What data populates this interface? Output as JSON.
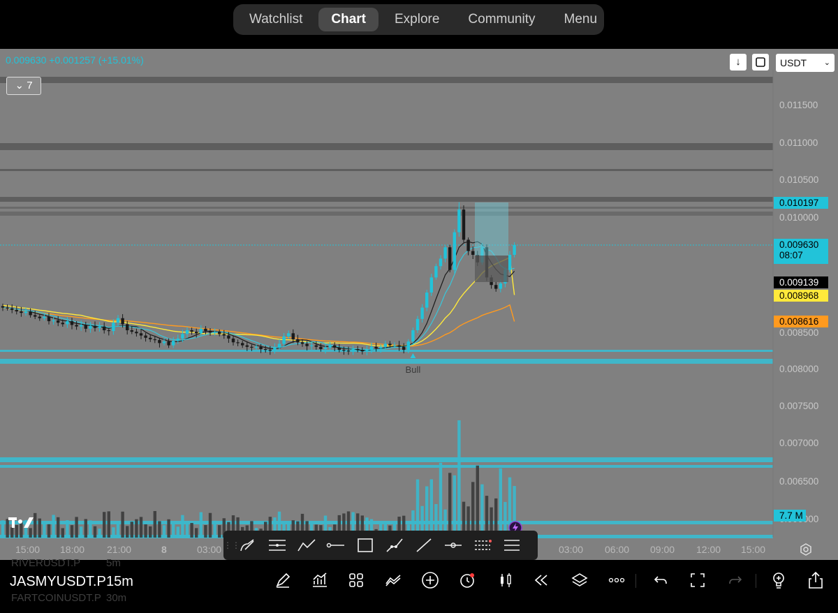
{
  "nav": {
    "tabs": [
      "Watchlist",
      "Chart",
      "Explore",
      "Community",
      "Menu"
    ],
    "active": "Chart"
  },
  "header": {
    "last_price": "0.009630",
    "change": "+0.001257",
    "change_pct": "(+15.01%)",
    "layers_count": "7",
    "currency": "USDT"
  },
  "axis": {
    "y_ticks": [
      "0.011500",
      "0.011000",
      "0.010500",
      "0.010000",
      "0.008500",
      "0.008000",
      "0.007500",
      "0.007000",
      "0.006500",
      "0.006000"
    ],
    "x_ticks": [
      "15:00",
      "18:00",
      "21:00",
      "8",
      "03:00",
      "03:00",
      "06:00",
      "09:00",
      "12:00",
      "15:00"
    ]
  },
  "price_tags": {
    "high": "0.010197",
    "current": "0.009630",
    "countdown": "08:07",
    "ma_fast": "0.009139",
    "ma_yellow": "0.008968",
    "ma_orange": "0.008616",
    "volume": "7.7 M"
  },
  "annotation": "Bull",
  "colors": {
    "up": "#22c3d9",
    "down": "#1a1a1a",
    "yellow": "#ffe93b",
    "orange": "#ff9a1f",
    "chart_bg": "#808080"
  },
  "toolbar_icons": [
    "brush-icon",
    "horizontal-lines-icon",
    "trend-icon",
    "horizontal-ray-icon",
    "rectangle-icon",
    "path-icon",
    "line-icon",
    "cross-line-icon",
    "fib-icon",
    "parallel-lines-icon"
  ],
  "bottom": {
    "symbol": "JASMYUSDT.P",
    "interval": "15m",
    "ghost_symbol_1": "RIVERUSDT.P",
    "ghost_interval_1": "5m",
    "ghost_symbol_2": "FARTCOINUSDT.P",
    "ghost_interval_2": "30m"
  },
  "chart_data": {
    "type": "candlestick",
    "last": 0.00963,
    "high": 0.010197,
    "closes": [
      0.0088,
      0.00879,
      0.00877,
      0.00875,
      0.00873,
      0.00875,
      0.0087,
      0.00868,
      0.00866,
      0.00868,
      0.00862,
      0.00863,
      0.0086,
      0.00858,
      0.00862,
      0.00857,
      0.00855,
      0.00857,
      0.00852,
      0.00856,
      0.00853,
      0.00855,
      0.0085,
      0.00849,
      0.0086,
      0.00866,
      0.00858,
      0.0085,
      0.00848,
      0.00846,
      0.00843,
      0.0084,
      0.00838,
      0.00837,
      0.00833,
      0.00835,
      0.0083,
      0.00836,
      0.00839,
      0.00845,
      0.0085,
      0.00848,
      0.00846,
      0.00852,
      0.00849,
      0.00847,
      0.00848,
      0.00845,
      0.00843,
      0.00839,
      0.00834,
      0.00833,
      0.0083,
      0.00828,
      0.00827,
      0.00828,
      0.00825,
      0.00824,
      0.00823,
      0.00827,
      0.00832,
      0.00842,
      0.00846,
      0.00838,
      0.00834,
      0.00832,
      0.00829,
      0.0083,
      0.00828,
      0.00825,
      0.00827,
      0.0083,
      0.00827,
      0.00824,
      0.00823,
      0.00822,
      0.00825,
      0.00824,
      0.00822,
      0.00824,
      0.00828,
      0.00826,
      0.00828,
      0.00832,
      0.0083,
      0.0083,
      0.00828,
      0.00824,
      0.00835,
      0.0085,
      0.00865,
      0.0088,
      0.009,
      0.0092,
      0.00935,
      0.00945,
      0.0096,
      0.0093,
      0.0098,
      0.0101,
      0.0097,
      0.00955,
      0.0095,
      0.0094,
      0.0096,
      0.0092,
      0.0091,
      0.00905,
      0.00912,
      0.0093,
      0.0095,
      0.00963
    ],
    "volume_peak_m": 17.5,
    "volume_last_m": 7.7,
    "ma_yellow_last": 0.008968,
    "ma_orange_last": 0.008616,
    "annotation": "Bull"
  }
}
